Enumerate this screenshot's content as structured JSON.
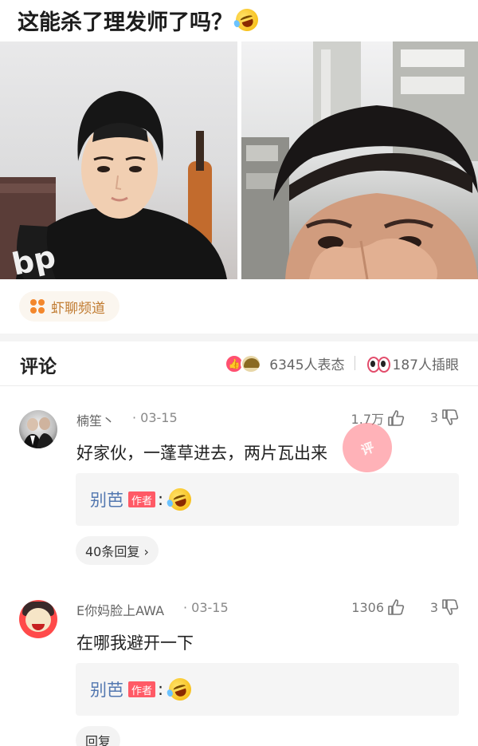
{
  "post": {
    "title": "这能杀了理发师了吗？",
    "title_emoji": "laughing-crying-emoji"
  },
  "channel": {
    "label": "虾聊频道",
    "icon": "four-dots-icon",
    "color": "#c07a2f"
  },
  "comments_header": {
    "title": "评论",
    "reaction_count": "6345人表态",
    "peek_count": "187人插眼"
  },
  "comments": [
    {
      "user": "楠笙丶",
      "date": "· 03-15",
      "likes": "1.7万",
      "dislikes": "3",
      "text": "好家伙，一蓬草进去，两片瓦出来",
      "reply": {
        "name": "别芭",
        "badge": "作者",
        "colon": ":"
      },
      "reply_link": "40条回复 ›"
    },
    {
      "user": "E你妈脸上AWA",
      "date": "· 03-15",
      "likes": "1306",
      "dislikes": "3",
      "text": "在哪我避开一下",
      "reply": {
        "name": "别芭",
        "badge": "作者",
        "colon": ":"
      },
      "reply_link": "回复"
    }
  ],
  "stamp_text": "评",
  "colors": {
    "accent_red": "#ff5a66",
    "reply_blue": "#5277b0",
    "like_pink": "#ff5070"
  }
}
